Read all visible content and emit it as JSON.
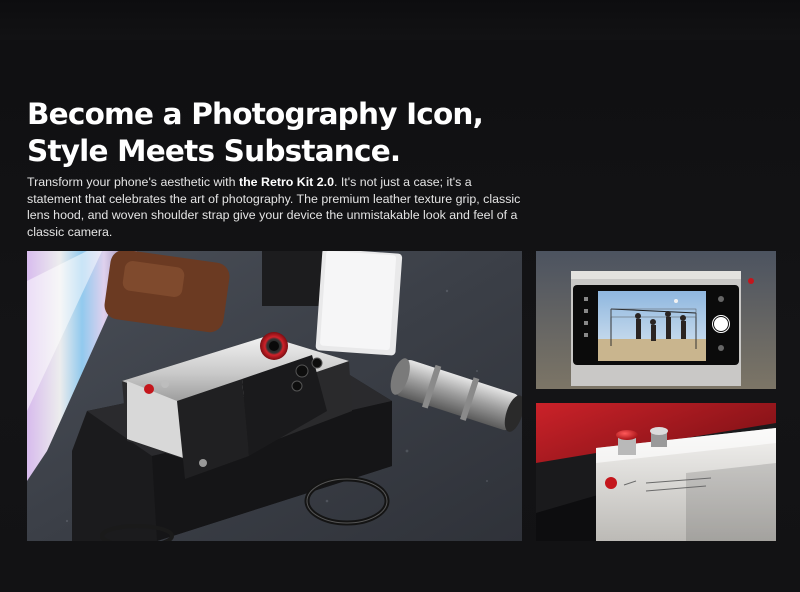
{
  "hero": {
    "headline": "Become a Photography Icon, Style Meets Substance.",
    "description_prefix": "Transform your phone's aesthetic with ",
    "description_product": "the Retro Kit 2.0",
    "description_suffix": ". It's not just a case; it's a statement that celebrates the art of photography. The premium leather texture grip, classic lens hood, and woven shoulder strap give your device the unmistakable look and feel of a classic camera."
  },
  "gallery": {
    "main_alt": "Retro Kit 2.0 phone case with lens hood and strap on a dark stone surface",
    "top_right_alt": "Phone camera app capturing a beach volleyball game",
    "bottom_right_alt": "Close-up of red shutter button on the retro case"
  },
  "colors": {
    "background": "#121214",
    "accent_red": "#c4161c"
  }
}
